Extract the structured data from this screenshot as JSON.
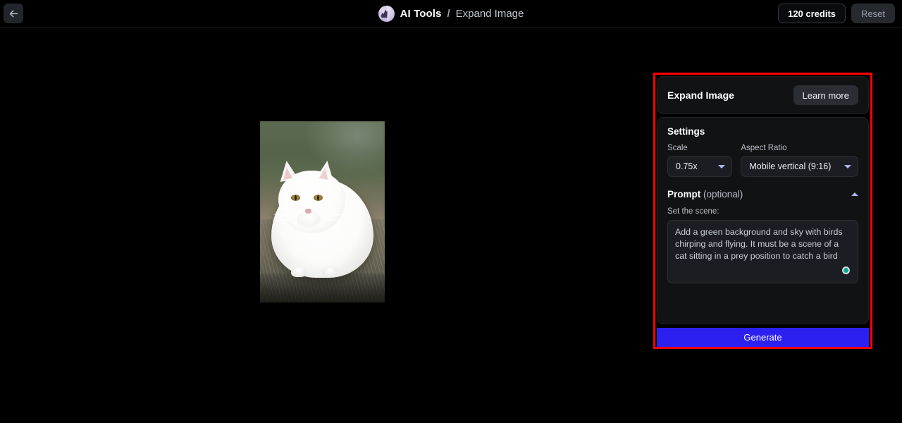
{
  "header": {
    "back_icon": "arrow-left-icon",
    "logo_icon": "ai-tools-logo-icon",
    "brand": "AI Tools",
    "separator": "/",
    "page": "Expand Image",
    "credits": "120 credits",
    "reset": "Reset"
  },
  "canvas": {
    "image_alt": "white cat sitting on grass"
  },
  "panel": {
    "highlight_color": "#ff0000",
    "title": "Expand Image",
    "learn_more": "Learn more",
    "settings": {
      "title": "Settings",
      "scale": {
        "label": "Scale",
        "value": "0.75x",
        "caret_icon": "chevron-down-icon"
      },
      "aspect_ratio": {
        "label": "Aspect Ratio",
        "value": "Mobile vertical (9:16)",
        "caret_icon": "chevron-down-icon"
      }
    },
    "prompt": {
      "title": "Prompt",
      "optional": "(optional)",
      "toggle_icon": "chevron-up-icon",
      "sub_label": "Set the scene:",
      "value": "Add a green background and sky with birds chirping and flying. It must be a scene of a cat sitting in a prey position to catch a bird",
      "indicator_icon": "status-dot-icon",
      "indicator_color": "#12a88a"
    },
    "generate": {
      "label": "Generate",
      "color": "#2b20f0"
    }
  }
}
